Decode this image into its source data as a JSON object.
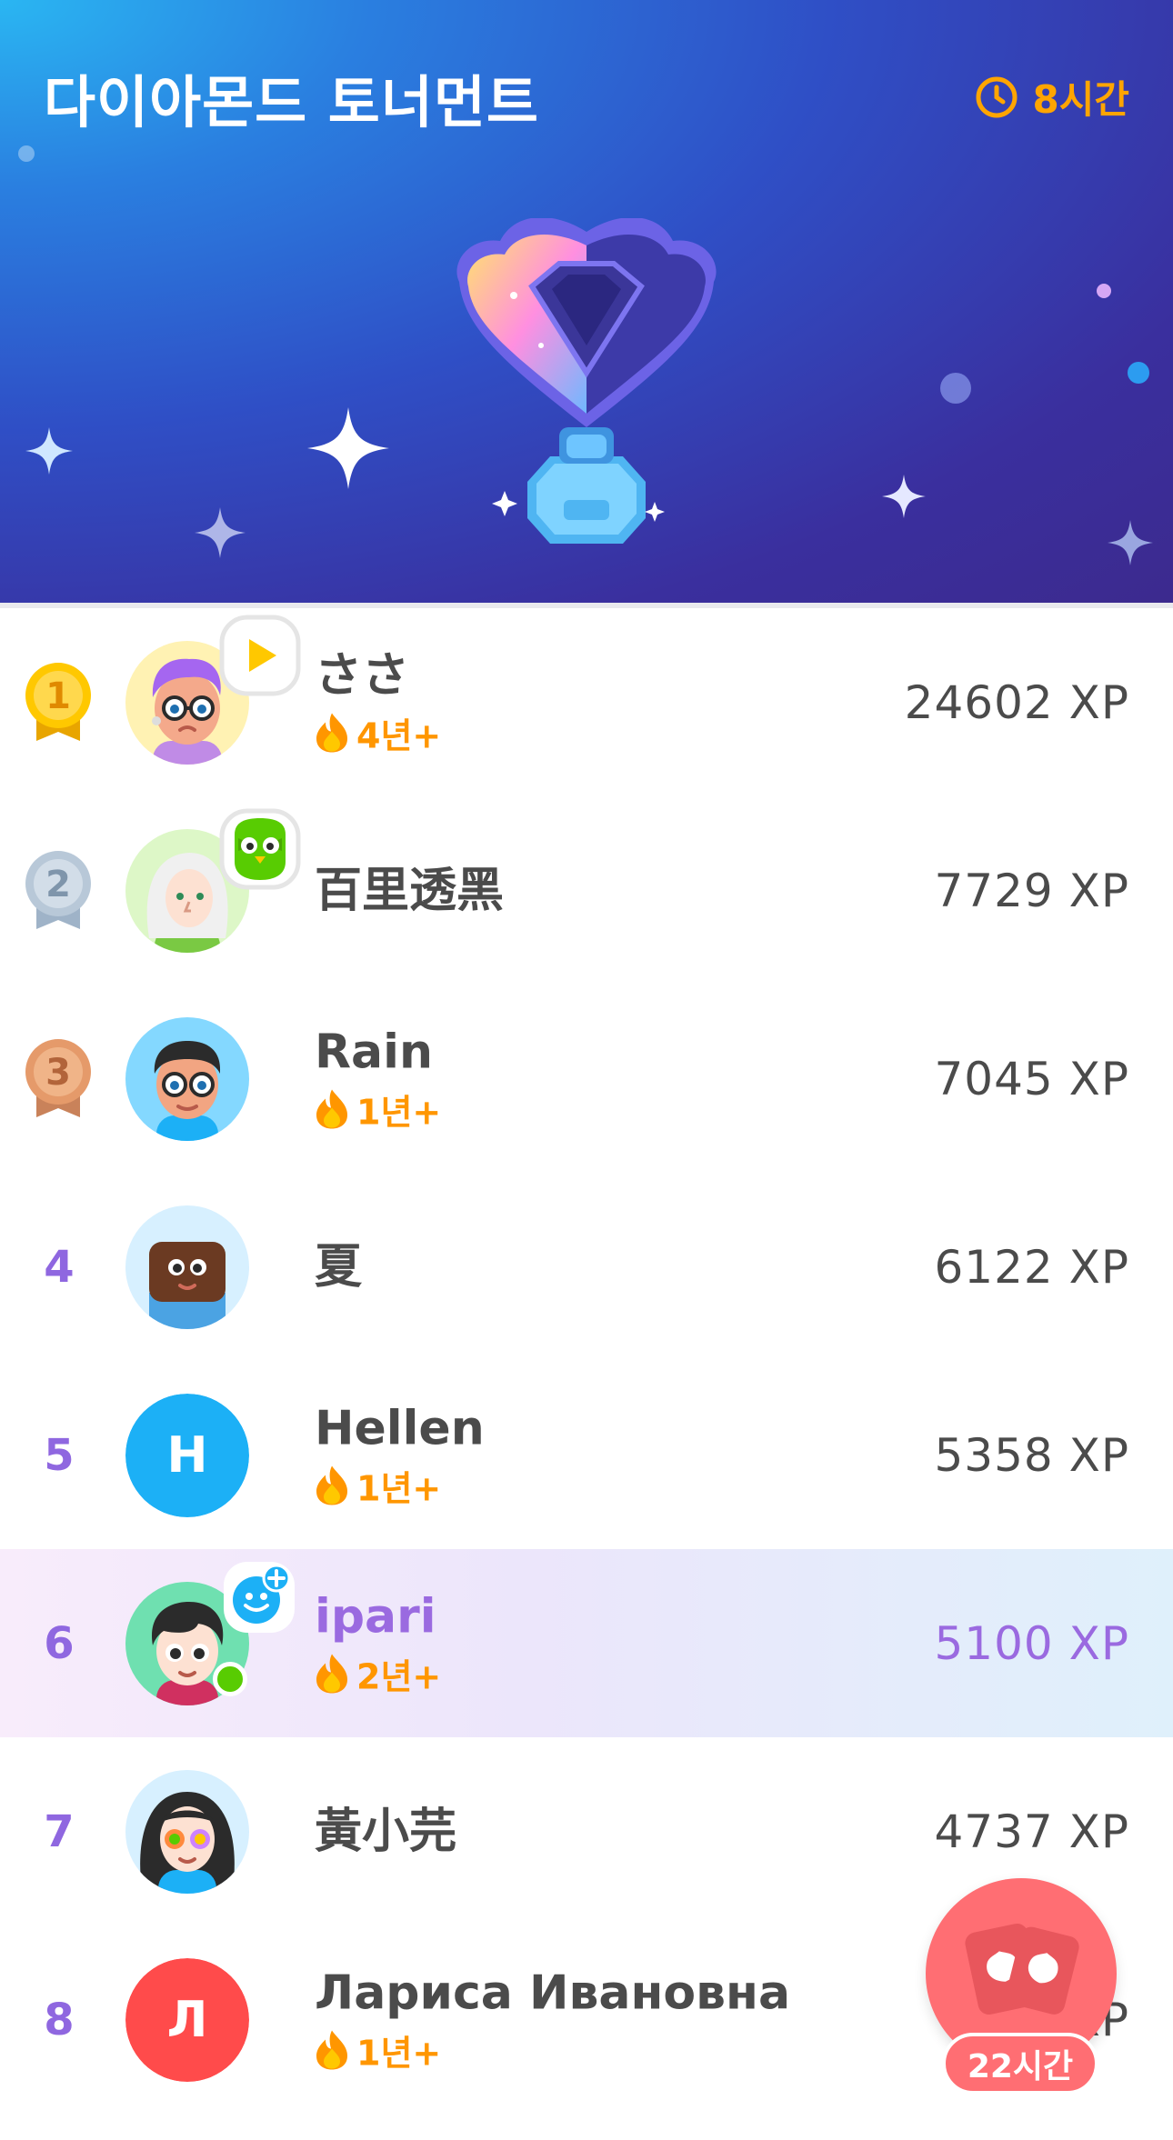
{
  "header": {
    "title": "다이아몬드 토너먼트",
    "timer": "8시간",
    "colors": {
      "accent_orange": "#FFA500",
      "bg_start": "#2AB6F2",
      "bg_end": "#3C2A8E"
    }
  },
  "leaderboard": [
    {
      "rank": "1",
      "medal": "gold",
      "name": "ささ",
      "streak": "4년+",
      "xp": "24602 XP",
      "avatar": "purple-hair-glasses-avatar",
      "badge": "play-badge"
    },
    {
      "rank": "2",
      "medal": "silver",
      "name": "百里透黑",
      "streak": "",
      "xp": "7729 XP",
      "avatar": "white-hair-avatar",
      "badge": "duo-owl-badge"
    },
    {
      "rank": "3",
      "medal": "bronze",
      "name": "Rain",
      "streak": "1년+",
      "xp": "7045 XP",
      "avatar": "glasses-boy-avatar"
    },
    {
      "rank": "4",
      "name": "夏",
      "streak": "",
      "xp": "6122 XP",
      "avatar": "brown-face-avatar"
    },
    {
      "rank": "5",
      "name": "Hellen",
      "streak": "1년+",
      "xp": "5358 XP",
      "avatar_letter": "H",
      "avatar_color": "#1CB0F6"
    },
    {
      "rank": "6",
      "name": "ipari",
      "streak": "2년+",
      "xp": "5100 XP",
      "avatar": "black-hair-avatar",
      "badge": "add-friend-badge",
      "is_me": true,
      "online": true
    },
    {
      "rank": "7",
      "name": "黃小芫",
      "streak": "",
      "xp": "4737 XP",
      "avatar": "rainbow-glasses-girl-avatar"
    },
    {
      "rank": "8",
      "name": "Лариса Ивановна",
      "streak": "1년+",
      "xp": "4… XP",
      "avatar_letter": "Л",
      "avatar_color": "#FF4B4B"
    }
  ],
  "fab": {
    "timer": "22시간",
    "icon": "chest-cards-icon",
    "color": "#FF6E73"
  }
}
